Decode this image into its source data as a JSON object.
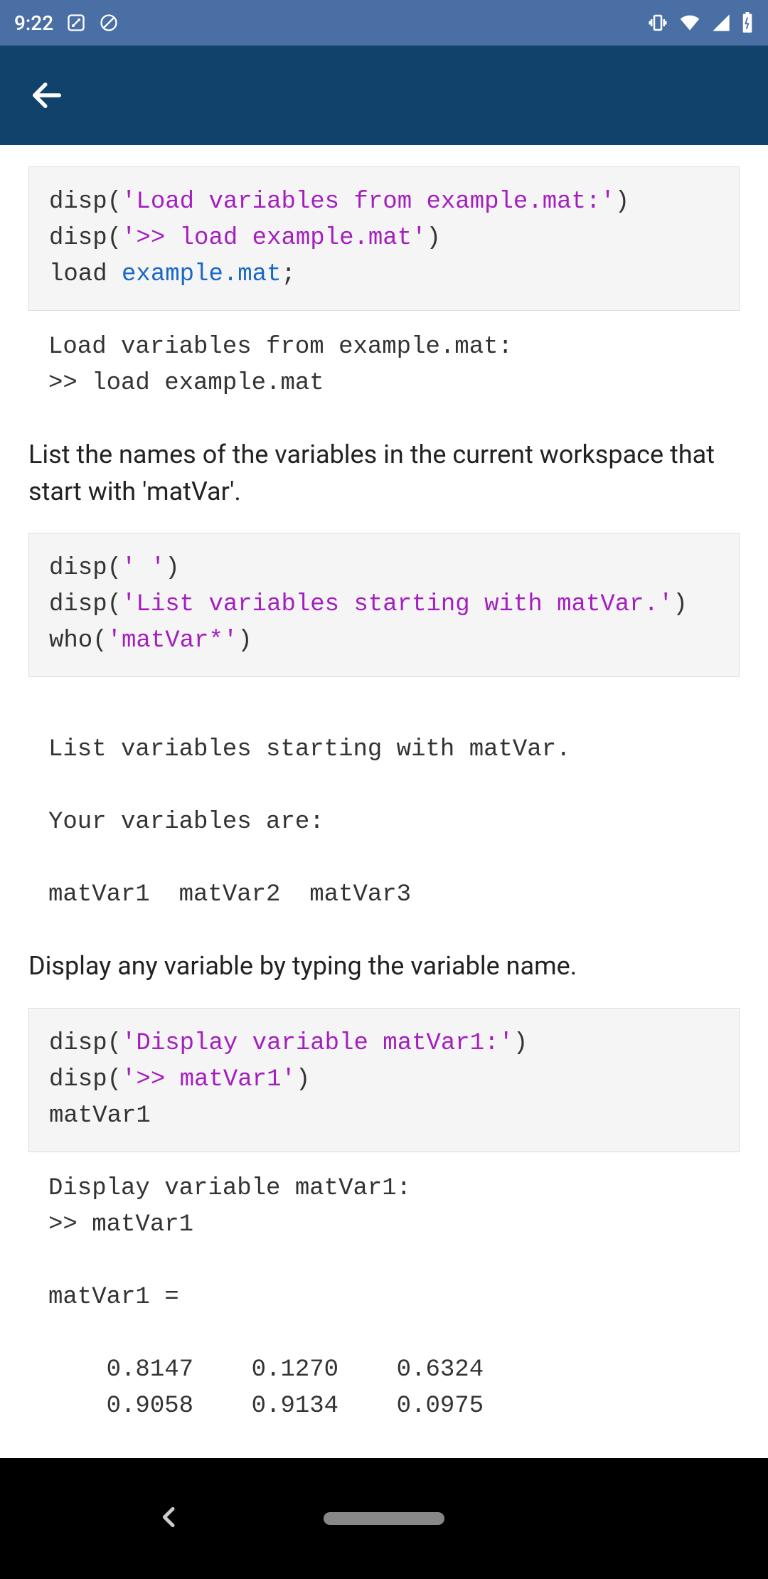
{
  "status": {
    "time": "9:22",
    "icons_left": [
      "target-icon",
      "no-sign-icon"
    ],
    "icons_right": [
      "vibrate-icon",
      "wifi-icon",
      "cell-icon",
      "battery-charging-icon"
    ]
  },
  "code1": {
    "line1_pre": "disp(",
    "line1_str": "'Load variables from example.mat:'",
    "line1_post": ")",
    "line2_pre": "disp(",
    "line2_str": "'>> load example.mat'",
    "line2_post": ")",
    "line3_pre": "load ",
    "line3_cmd": "example.mat",
    "line3_post": ";"
  },
  "output1": "Load variables from example.mat:\n>> load example.mat",
  "prose1": "List the names of the variables in the current workspace that start with 'matVar'.",
  "code2": {
    "line1_pre": "disp(",
    "line1_str": "' '",
    "line1_post": ")",
    "line2_pre": "disp(",
    "line2_str": "'List variables starting with matVar.'",
    "line2_post": ")",
    "line3_pre": "who(",
    "line3_str": "'matVar*'",
    "line3_post": ")"
  },
  "output2": " \nList variables starting with matVar.\n\nYour variables are:\n\nmatVar1  matVar2  matVar3  \n",
  "prose2": "Display any variable by typing the variable name.",
  "code3": {
    "line1_pre": "disp(",
    "line1_str": "'Display variable matVar1:'",
    "line1_post": ")",
    "line2_pre": "disp(",
    "line2_str": "'>> matVar1'",
    "line2_post": ")",
    "line3": "matVar1"
  },
  "output3": "Display variable matVar1:\n>> matVar1\n\nmatVar1 =\n\n    0.8147    0.1270    0.6324\n    0.9058    0.9134    0.0975\n"
}
